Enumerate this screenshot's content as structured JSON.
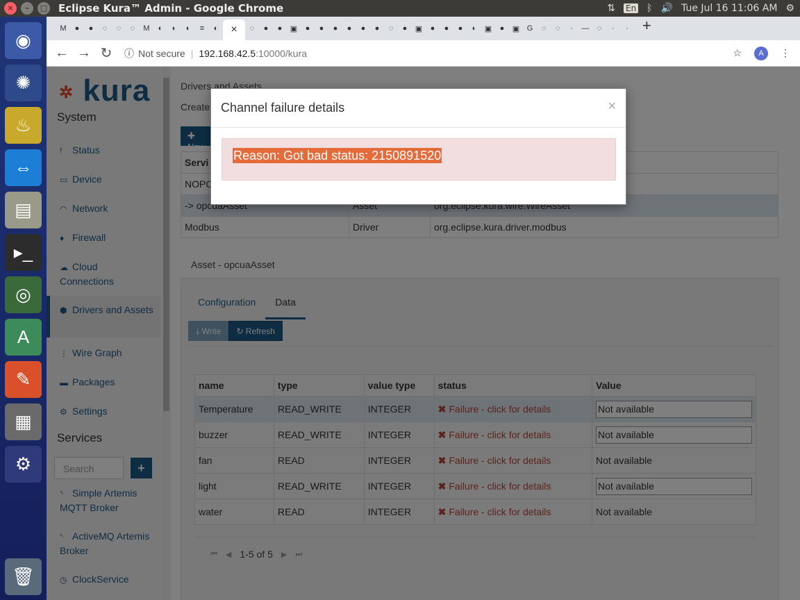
{
  "window": {
    "title": "Eclipse Kura™ Admin - Google Chrome",
    "lang": "En",
    "clock": "Tue Jul 16 11:06 AM"
  },
  "browser": {
    "security": "Not secure",
    "url_host": "192.168.42.5",
    "url_rest": ":10000/kura",
    "avatar": "A"
  },
  "sidebar": {
    "logo": "kura",
    "system_heading": "System",
    "items": [
      {
        "label": "Status",
        "icon": "exclamation-icon"
      },
      {
        "label": "Device",
        "icon": "hdd-icon"
      },
      {
        "label": "Network",
        "icon": "wifi-icon"
      },
      {
        "label": "Firewall",
        "icon": "fire-icon"
      },
      {
        "label": "Cloud Connections",
        "icon": "cloud-icon"
      },
      {
        "label": "Drivers and Assets",
        "icon": "cube-icon"
      },
      {
        "label": "Wire Graph",
        "icon": "sitemap-icon"
      },
      {
        "label": "Packages",
        "icon": "briefcase-icon"
      },
      {
        "label": "Settings",
        "icon": "gear-icon"
      }
    ],
    "services_heading": "Services",
    "search_placeholder": "Search",
    "services": [
      {
        "label": "Simple Artemis MQTT Broker"
      },
      {
        "label": "ActiveMQ Artemis Broker"
      },
      {
        "label": "ClockService"
      }
    ]
  },
  "main": {
    "breadcrumb": "Drivers and Assets",
    "create_text": "Create",
    "new_button": "New",
    "services_table": {
      "headers": [
        "Servi",
        "",
        ""
      ],
      "rows": [
        [
          "NOPO",
          "",
          ""
        ],
        [
          "-> opcuaAsset",
          "Asset",
          "org.eclipse.kura.wire.WireAsset"
        ],
        [
          "Modbus",
          "Driver",
          "org.eclipse.kura.driver.modbus"
        ]
      ]
    },
    "asset_title": "Asset - opcuaAsset",
    "tabs": [
      "Configuration",
      "Data"
    ],
    "write_button": "Write",
    "refresh_button": "Refresh",
    "data_table": {
      "headers": [
        "name",
        "type",
        "value type",
        "status",
        "Value"
      ],
      "rows": [
        {
          "name": "Temperature",
          "type": "READ_WRITE",
          "vtype": "INTEGER",
          "status": "Failure - click for details",
          "value": "Not available",
          "editable": true
        },
        {
          "name": "buzzer",
          "type": "READ_WRITE",
          "vtype": "INTEGER",
          "status": "Failure - click for details",
          "value": "Not available",
          "editable": true
        },
        {
          "name": "fan",
          "type": "READ",
          "vtype": "INTEGER",
          "status": "Failure - click for details",
          "value": "Not available",
          "editable": false
        },
        {
          "name": "light",
          "type": "READ_WRITE",
          "vtype": "INTEGER",
          "status": "Failure - click for details",
          "value": "Not available",
          "editable": true
        },
        {
          "name": "water",
          "type": "READ",
          "vtype": "INTEGER",
          "status": "Failure - click for details",
          "value": "Not available",
          "editable": false
        }
      ]
    },
    "pager": "1-5 of 5"
  },
  "modal": {
    "title": "Channel failure details",
    "close": "×",
    "reason": "Reason: Got bad status: 2150891520"
  },
  "colors": {
    "brand": "#1d5b86",
    "failure": "#b5473b",
    "alert_bg": "#f2dede",
    "highlight": "#e56b3b"
  }
}
